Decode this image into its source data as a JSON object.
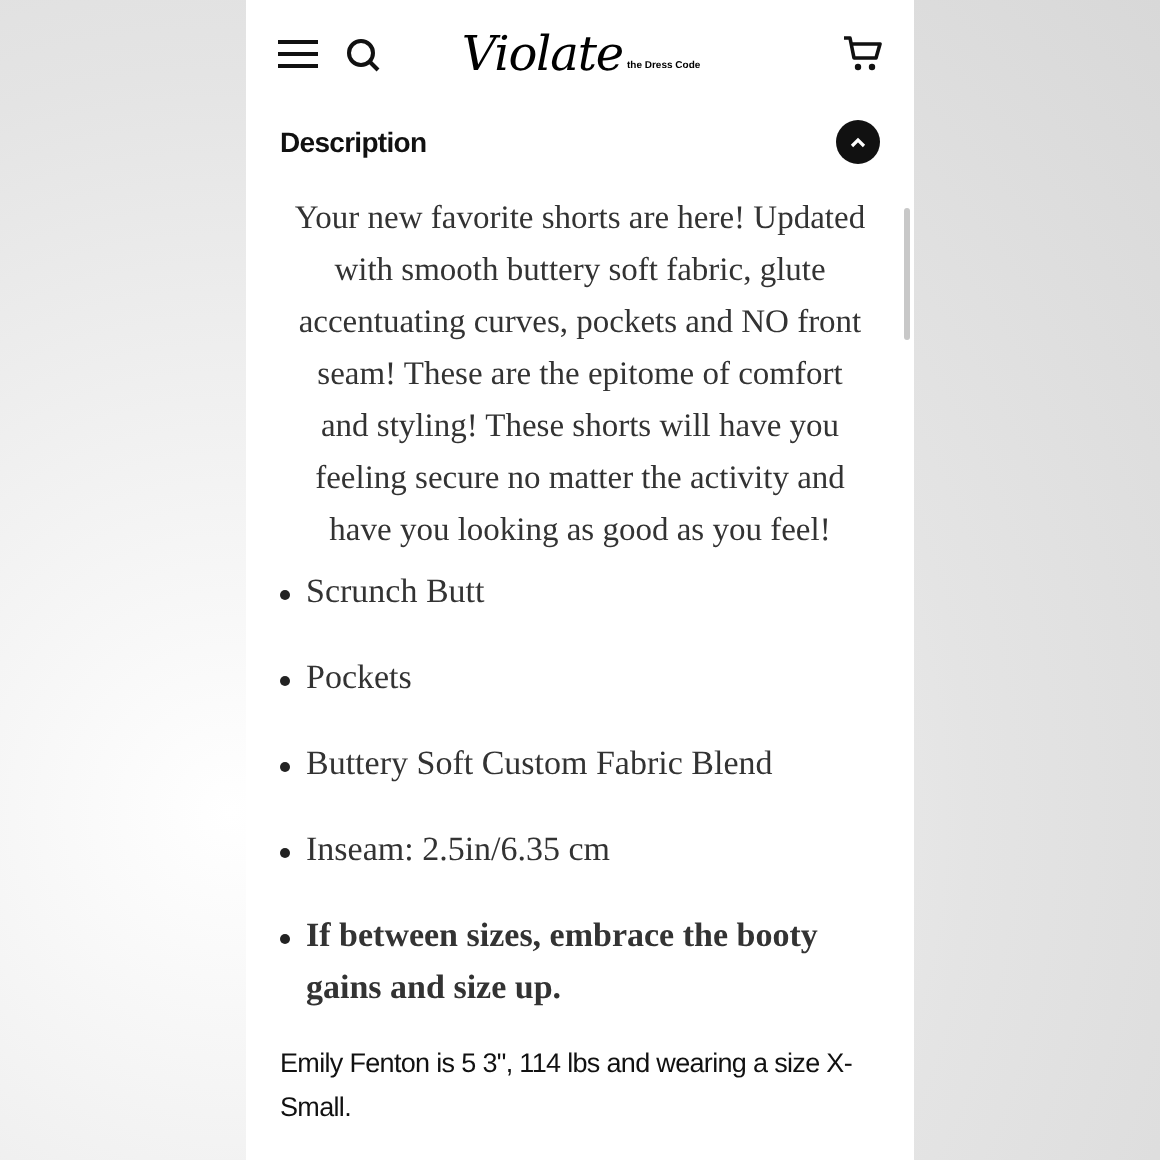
{
  "header": {
    "logo": "Violate",
    "logo_tagline": "the Dress Code"
  },
  "section": {
    "title": "Description",
    "expanded": true
  },
  "intro": "Your new favorite shorts are here! Updated with smooth buttery soft fabric, glute accentuating curves, pockets and NO front seam! These are the epitome of comfort and styling! These shorts will have you feeling secure no matter the activity and have you looking as good as you feel!",
  "bullets": [
    {
      "text": "Scrunch Butt",
      "bold": false
    },
    {
      "text": "Pockets",
      "bold": false
    },
    {
      "text": "Buttery Soft Custom Fabric Blend",
      "bold": false
    },
    {
      "text": "Inseam: 2.5in/6.35 cm",
      "bold": false
    },
    {
      "text": "If between sizes, embrace the booty gains and size up.",
      "bold": true
    }
  ],
  "model_note": "Emily Fenton is 5 3\", 114 lbs and wearing a size X-Small."
}
